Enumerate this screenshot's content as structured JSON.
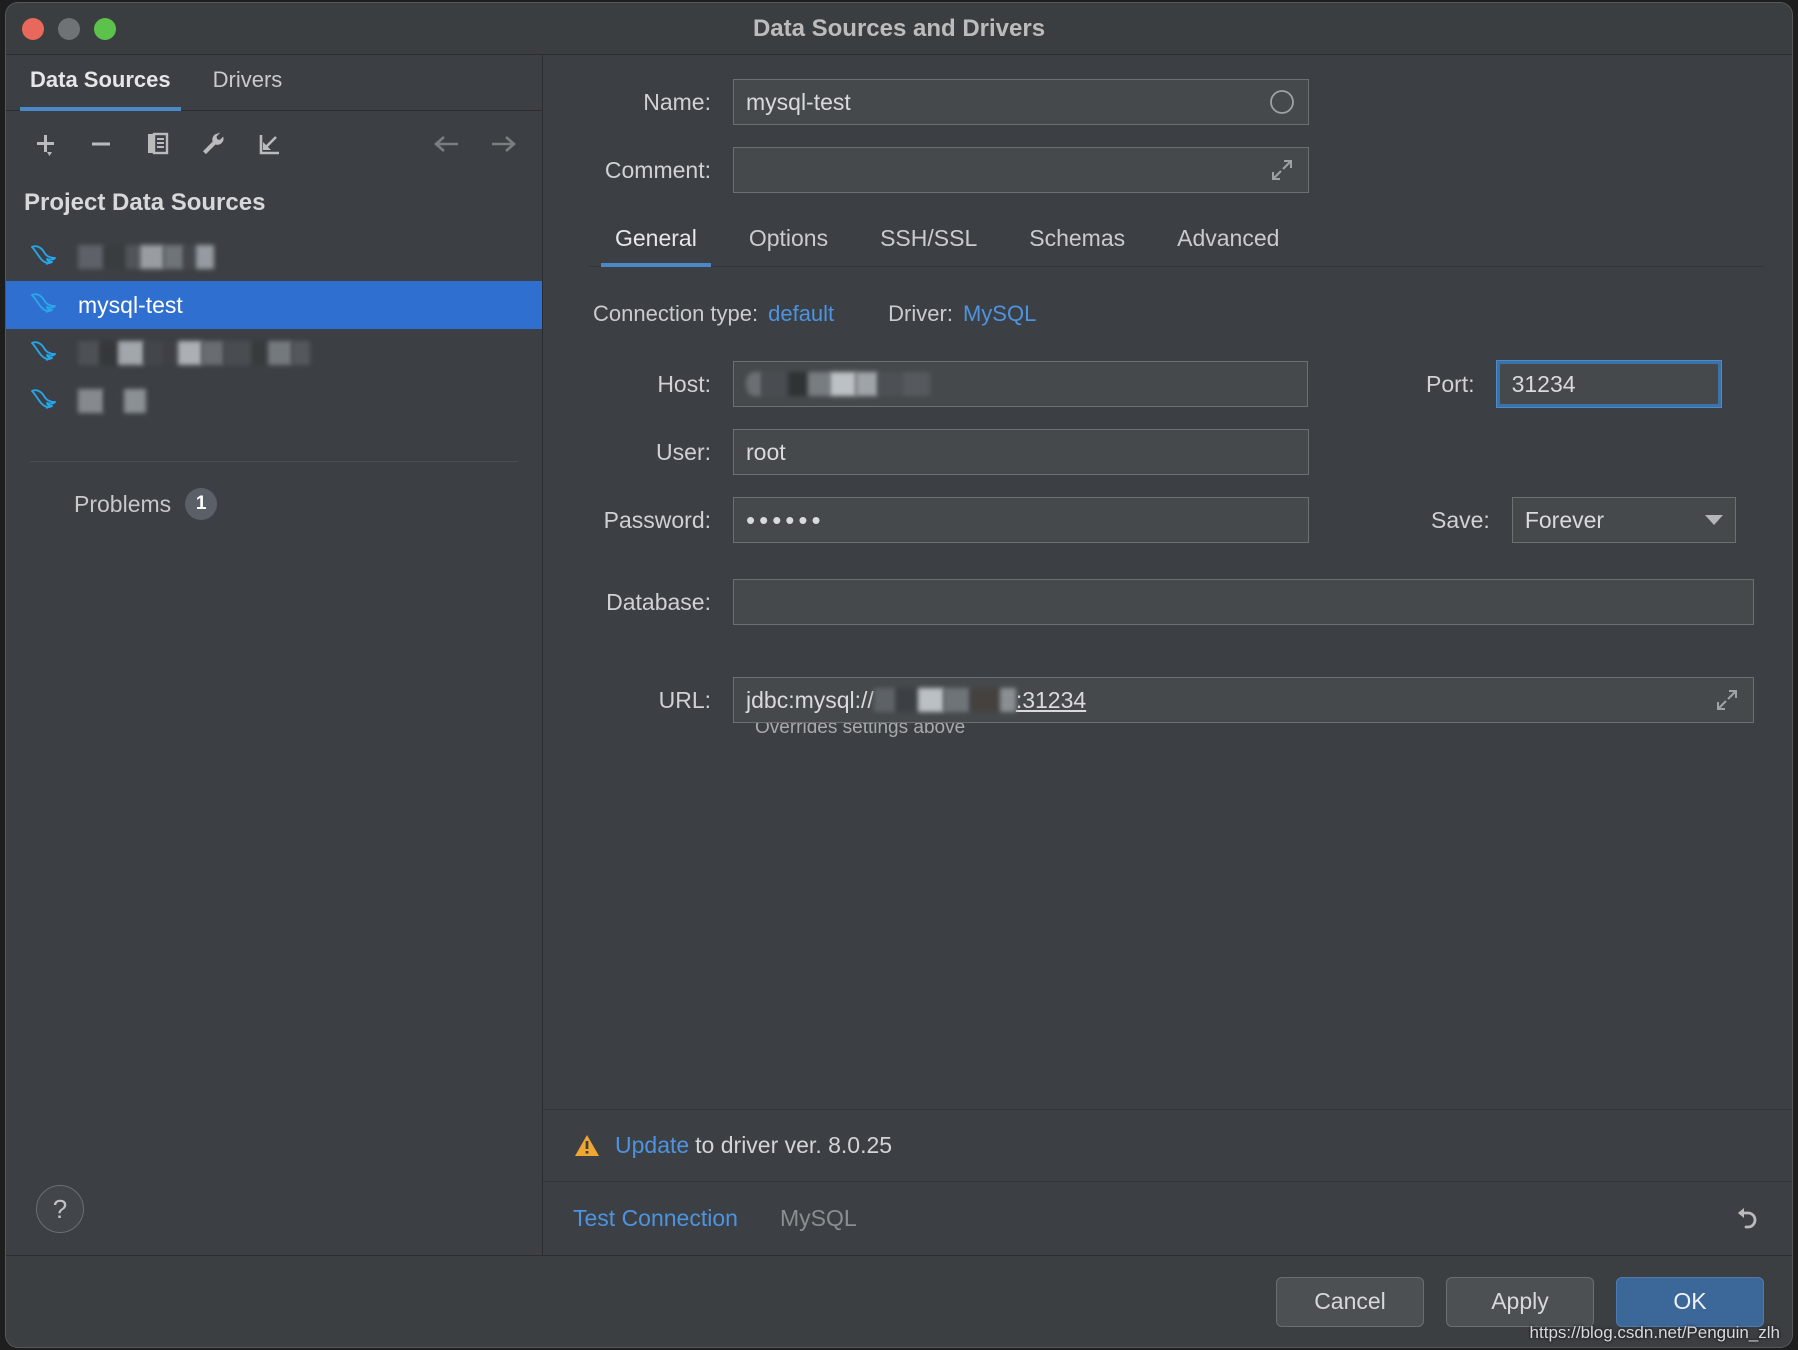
{
  "window": {
    "title": "Data Sources and Drivers",
    "traffic_lights": [
      "close-button",
      "minimize-button",
      "maximize-button"
    ]
  },
  "sidebar": {
    "tabs": [
      {
        "label": "Data Sources",
        "active": true
      },
      {
        "label": "Drivers",
        "active": false
      }
    ],
    "toolbar": [
      {
        "name": "add-data-source-button",
        "icon": "plus-icon"
      },
      {
        "name": "remove-data-source-button",
        "icon": "minus-icon"
      },
      {
        "name": "duplicate-data-source-button",
        "icon": "copy-icon"
      },
      {
        "name": "properties-button",
        "icon": "wrench-icon"
      },
      {
        "name": "import-button",
        "icon": "import-arrow-icon"
      },
      {
        "name": "nav-back-button",
        "icon": "arrow-left-icon"
      },
      {
        "name": "nav-forward-button",
        "icon": "arrow-right-icon"
      }
    ],
    "section_label": "Project Data Sources",
    "items": [
      {
        "label": "",
        "redacted": true,
        "selected": false,
        "icon": "mysql-dolphin-icon"
      },
      {
        "label": "mysql-test",
        "redacted": false,
        "selected": true,
        "icon": "mysql-dolphin-icon"
      },
      {
        "label": "",
        "redacted": true,
        "selected": false,
        "icon": "mysql-dolphin-icon"
      },
      {
        "label": "",
        "redacted": true,
        "selected": false,
        "icon": "mysql-dolphin-icon"
      }
    ],
    "problems": {
      "label": "Problems",
      "count": "1"
    },
    "help_button": "?"
  },
  "form": {
    "name": {
      "label": "Name:",
      "value": "mysql-test",
      "icon": "color-circle-icon"
    },
    "comment": {
      "label": "Comment:",
      "value": "",
      "placeholder": "",
      "icon": "expand-icon"
    },
    "tabs": [
      {
        "label": "General",
        "active": true
      },
      {
        "label": "Options",
        "active": false
      },
      {
        "label": "SSH/SSL",
        "active": false
      },
      {
        "label": "Schemas",
        "active": false
      },
      {
        "label": "Advanced",
        "active": false
      }
    ],
    "connection": {
      "type_label": "Connection type:",
      "type_value": "default",
      "driver_label": "Driver:",
      "driver_value": "MySQL"
    },
    "host": {
      "label": "Host:",
      "value": "",
      "redacted": true
    },
    "port": {
      "label": "Port:",
      "value": "31234",
      "focused": true
    },
    "user": {
      "label": "User:",
      "value": "root"
    },
    "password": {
      "label": "Password:",
      "value": "••••••"
    },
    "save": {
      "label": "Save:",
      "value": "Forever"
    },
    "database": {
      "label": "Database:",
      "value": ""
    },
    "url": {
      "label": "URL:",
      "prefix": "jdbc:mysql://",
      "host_redacted": true,
      "suffix": ":31234",
      "hint": "Overrides settings above"
    }
  },
  "warning": {
    "icon": "warning-triangle-icon",
    "link": "Update",
    "text": " to driver ver. 8.0.25"
  },
  "status": {
    "test_connection": "Test Connection",
    "driver": "MySQL",
    "revert_icon": "revert-arrow-icon"
  },
  "footer": {
    "cancel": "Cancel",
    "apply": "Apply",
    "ok": "OK"
  },
  "watermark": "https://blog.csdn.net/Penguin_zlh",
  "colors": {
    "accent_blue": "#4a88c7",
    "link_blue": "#4d93e0",
    "selection_blue": "#2f6fd0",
    "window_bg": "#3c4044",
    "field_bg": "#45494c",
    "warning_orange": "#f0a732",
    "ok_button": "#3c6899"
  }
}
